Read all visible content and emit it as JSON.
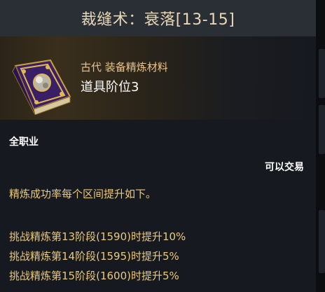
{
  "header": {
    "title": "裁缝术：衰落[13-15]"
  },
  "item": {
    "grade_type": "古代 装备精炼材料",
    "name": "道具阶位3",
    "icon": "ancient-tome-icon"
  },
  "class_requirement": "全职业",
  "trade_status": "可以交易",
  "description": "精炼成功率每个区间提升如下。",
  "bonuses": [
    "挑战精炼第13阶段(1590)时提升10%",
    "挑战精炼第14阶段(1595)时提升5%",
    "挑战精炼第15阶段(1600)时提升5%"
  ],
  "colors": {
    "title": "#e7d9b8",
    "grade": "#e8c48e",
    "highlight": "#e9c97a",
    "book_purple": "#4a2a7a",
    "book_gold": "#c9a040"
  }
}
